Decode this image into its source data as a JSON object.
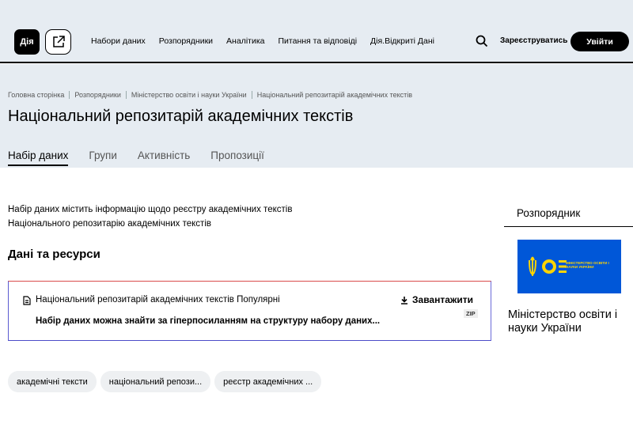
{
  "header": {
    "logo_text": "Дія",
    "nav": [
      "Набори даних",
      "Розпорядники",
      "Аналітика",
      "Питання та відповіді",
      "Дія.Відкриті Дані"
    ],
    "register": "Зареєструватись",
    "login": "Увійти"
  },
  "breadcrumb": [
    "Головна сторінка",
    "Розпорядники",
    "Міністерство освіти і науки України",
    "Національний репозитарій академічних текстів"
  ],
  "page_title": "Національний репозитарій академічних текстів",
  "tabs": [
    "Набір даних",
    "Групи",
    "Активність",
    "Пропозиції"
  ],
  "description_line1": "Набір даних містить інформацію щодо реєстру академічних текстів",
  "description_line2": "Національного репозитарію академічних  текстів",
  "section_title": "Дані та ресурси",
  "resource": {
    "name": "Національний репозитарій академічних текстів Популярні",
    "download": "Завантажити",
    "format": "ZIP",
    "description": "Набір даних можна знайти за гіперпосиланням на структуру набору даних..."
  },
  "tags": [
    "академічні тексти",
    "національний репози...",
    "реєстр академічних ..."
  ],
  "sidebar": {
    "title": "Розпорядник",
    "org_logo_text": "МІНІСТЕРСТВО ОСВІТИ І НАУКИ УКРАЇНИ",
    "org_name": "Міністерство освіти і науки України"
  },
  "colors": {
    "org_blue": "#0057d8",
    "org_yellow": "#ffd400",
    "header_bg": "#e6ecf2"
  }
}
